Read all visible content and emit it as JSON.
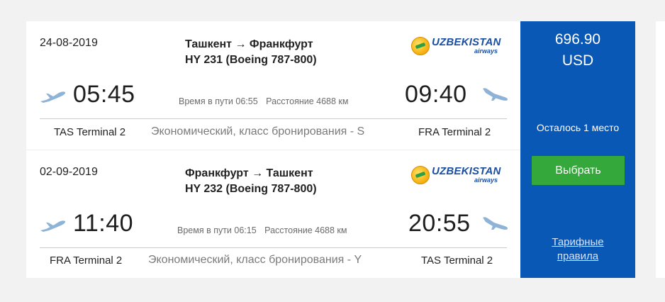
{
  "segments": [
    {
      "date": "24-08-2019",
      "route": "Ташкент → Франкфурт",
      "flight": "HY 231 (Boeing 787-800)",
      "airline": {
        "name": "UZBEKISTAN",
        "sub": "airways"
      },
      "departure_time": "05:45",
      "arrival_time": "09:40",
      "duration": "Время в пути 06:55",
      "distance": "Расстояние 4688 км",
      "departure_terminal": "TAS Terminal 2",
      "cabin": "Экономический, класс бронирования - S",
      "arrival_terminal": "FRA Terminal 2"
    },
    {
      "date": "02-09-2019",
      "route": "Франкфурт → Ташкент",
      "flight": "HY 232 (Boeing 787-800)",
      "airline": {
        "name": "UZBEKISTAN",
        "sub": "airways"
      },
      "departure_time": "11:40",
      "arrival_time": "20:55",
      "duration": "Время в пути 06:15",
      "distance": "Расстояние 4688 км",
      "departure_terminal": "FRA Terminal 2",
      "cabin": "Экономический, класс бронирования - Y",
      "arrival_terminal": "TAS Terminal 2"
    }
  ],
  "price": {
    "amount": "696.90",
    "currency": "USD"
  },
  "seats_left": "Осталось 1 место",
  "select_button": "Выбрать",
  "fare_rules_link": "Тарифные правила",
  "icons": {
    "takeoff": "plane-takeoff-icon",
    "landing": "plane-landing-icon"
  },
  "colors": {
    "price_panel": "#0a58b5",
    "select_button": "#35a83b",
    "airline_brand": "#1c4fa0"
  }
}
